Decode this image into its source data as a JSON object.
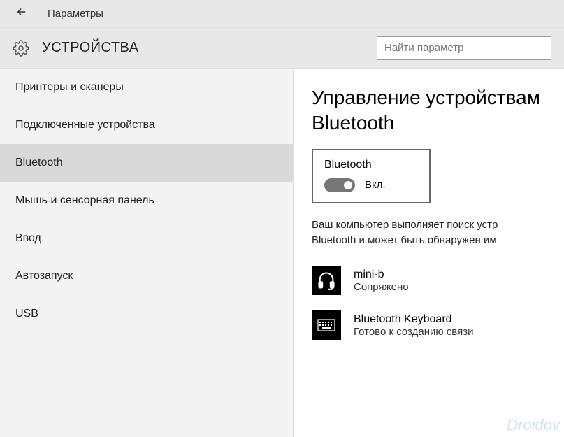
{
  "titlebar": {
    "title": "Параметры"
  },
  "header": {
    "category": "УСТРОЙСТВА",
    "search_placeholder": "Найти параметр"
  },
  "sidebar": {
    "items": [
      {
        "label": "Принтеры и сканеры"
      },
      {
        "label": "Подключенные устройства"
      },
      {
        "label": "Bluetooth"
      },
      {
        "label": "Мышь и сенсорная панель"
      },
      {
        "label": "Ввод"
      },
      {
        "label": "Автозапуск"
      },
      {
        "label": "USB"
      }
    ],
    "selected_index": 2
  },
  "content": {
    "heading": "Управление устройствам\nBluetooth",
    "heading_line1": "Управление устройствам",
    "heading_line2": "Bluetooth",
    "toggle": {
      "label": "Bluetooth",
      "state": "Вкл.",
      "on": true
    },
    "status_line1": "Ваш компьютер выполняет поиск устр",
    "status_line2": "Bluetooth и может быть обнаружен им",
    "devices": [
      {
        "icon": "headset-icon",
        "name": "mini-b",
        "status": "Сопряжено"
      },
      {
        "icon": "keyboard-icon",
        "name": "Bluetooth Keyboard",
        "status": "Готово к созданию связи"
      }
    ]
  },
  "watermark": "Droidov"
}
